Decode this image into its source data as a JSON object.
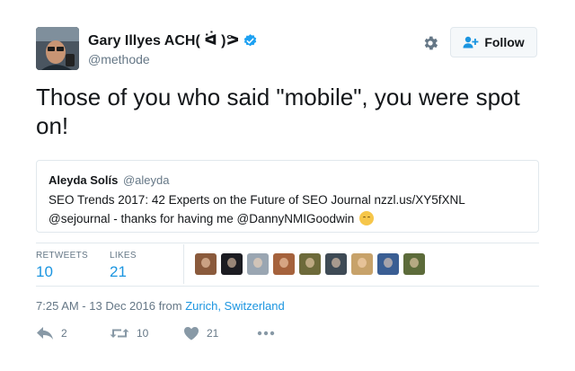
{
  "author": {
    "display_name": "Gary Illyes ACH( ᐛ )ᕗ",
    "handle": "@methode",
    "verified": true,
    "avatar_icon": "avatar-photo"
  },
  "header": {
    "follow_label": "Follow",
    "settings_icon": "gear-icon",
    "follow_icon": "add-person-icon"
  },
  "tweet": {
    "text": "Those of you who said \"mobile\", you were spot on!"
  },
  "quoted_tweet": {
    "name": "Aleyda Solís",
    "handle": "@aleyda",
    "text": "SEO Trends 2017: 42 Experts on the Future of SEO Journal nzzl.us/XY5fXNL @sejournal - thanks for having me @DannyNMIGoodwin",
    "emoji": "smiling-blush-emoji"
  },
  "stats": {
    "retweets_label": "RETWEETS",
    "retweets_value": "10",
    "likes_label": "LIKES",
    "likes_value": "21",
    "liker_avatar_colors": [
      "#8a5a3c",
      "#1c1c22",
      "#9aa6b2",
      "#a5623c",
      "#6d6a3a",
      "#3e4a55",
      "#c7a26a",
      "#3a5e93",
      "#5c6b3a"
    ]
  },
  "timestamp": {
    "prefix": "7:25 AM - 13 Dec 2016 from ",
    "place": "Zurich, Switzerland"
  },
  "actions": {
    "reply_count": "2",
    "retweet_count": "10",
    "like_count": "21",
    "more_icon": "more-dots-icon"
  },
  "colors": {
    "link": "#1b95e0",
    "verified": "#1da1f2",
    "secondary": "#657786"
  }
}
